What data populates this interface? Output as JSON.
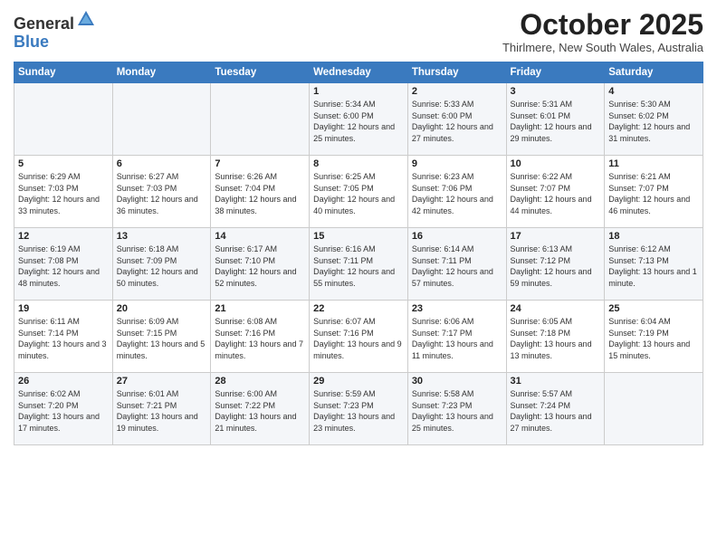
{
  "header": {
    "logo_general": "General",
    "logo_blue": "Blue",
    "month_title": "October 2025",
    "location": "Thirlmere, New South Wales, Australia"
  },
  "weekdays": [
    "Sunday",
    "Monday",
    "Tuesday",
    "Wednesday",
    "Thursday",
    "Friday",
    "Saturday"
  ],
  "weeks": [
    [
      {
        "day": "",
        "sunrise": "",
        "sunset": "",
        "daylight": ""
      },
      {
        "day": "",
        "sunrise": "",
        "sunset": "",
        "daylight": ""
      },
      {
        "day": "",
        "sunrise": "",
        "sunset": "",
        "daylight": ""
      },
      {
        "day": "1",
        "sunrise": "Sunrise: 5:34 AM",
        "sunset": "Sunset: 6:00 PM",
        "daylight": "Daylight: 12 hours and 25 minutes."
      },
      {
        "day": "2",
        "sunrise": "Sunrise: 5:33 AM",
        "sunset": "Sunset: 6:00 PM",
        "daylight": "Daylight: 12 hours and 27 minutes."
      },
      {
        "day": "3",
        "sunrise": "Sunrise: 5:31 AM",
        "sunset": "Sunset: 6:01 PM",
        "daylight": "Daylight: 12 hours and 29 minutes."
      },
      {
        "day": "4",
        "sunrise": "Sunrise: 5:30 AM",
        "sunset": "Sunset: 6:02 PM",
        "daylight": "Daylight: 12 hours and 31 minutes."
      }
    ],
    [
      {
        "day": "5",
        "sunrise": "Sunrise: 6:29 AM",
        "sunset": "Sunset: 7:03 PM",
        "daylight": "Daylight: 12 hours and 33 minutes."
      },
      {
        "day": "6",
        "sunrise": "Sunrise: 6:27 AM",
        "sunset": "Sunset: 7:03 PM",
        "daylight": "Daylight: 12 hours and 36 minutes."
      },
      {
        "day": "7",
        "sunrise": "Sunrise: 6:26 AM",
        "sunset": "Sunset: 7:04 PM",
        "daylight": "Daylight: 12 hours and 38 minutes."
      },
      {
        "day": "8",
        "sunrise": "Sunrise: 6:25 AM",
        "sunset": "Sunset: 7:05 PM",
        "daylight": "Daylight: 12 hours and 40 minutes."
      },
      {
        "day": "9",
        "sunrise": "Sunrise: 6:23 AM",
        "sunset": "Sunset: 7:06 PM",
        "daylight": "Daylight: 12 hours and 42 minutes."
      },
      {
        "day": "10",
        "sunrise": "Sunrise: 6:22 AM",
        "sunset": "Sunset: 7:07 PM",
        "daylight": "Daylight: 12 hours and 44 minutes."
      },
      {
        "day": "11",
        "sunrise": "Sunrise: 6:21 AM",
        "sunset": "Sunset: 7:07 PM",
        "daylight": "Daylight: 12 hours and 46 minutes."
      }
    ],
    [
      {
        "day": "12",
        "sunrise": "Sunrise: 6:19 AM",
        "sunset": "Sunset: 7:08 PM",
        "daylight": "Daylight: 12 hours and 48 minutes."
      },
      {
        "day": "13",
        "sunrise": "Sunrise: 6:18 AM",
        "sunset": "Sunset: 7:09 PM",
        "daylight": "Daylight: 12 hours and 50 minutes."
      },
      {
        "day": "14",
        "sunrise": "Sunrise: 6:17 AM",
        "sunset": "Sunset: 7:10 PM",
        "daylight": "Daylight: 12 hours and 52 minutes."
      },
      {
        "day": "15",
        "sunrise": "Sunrise: 6:16 AM",
        "sunset": "Sunset: 7:11 PM",
        "daylight": "Daylight: 12 hours and 55 minutes."
      },
      {
        "day": "16",
        "sunrise": "Sunrise: 6:14 AM",
        "sunset": "Sunset: 7:11 PM",
        "daylight": "Daylight: 12 hours and 57 minutes."
      },
      {
        "day": "17",
        "sunrise": "Sunrise: 6:13 AM",
        "sunset": "Sunset: 7:12 PM",
        "daylight": "Daylight: 12 hours and 59 minutes."
      },
      {
        "day": "18",
        "sunrise": "Sunrise: 6:12 AM",
        "sunset": "Sunset: 7:13 PM",
        "daylight": "Daylight: 13 hours and 1 minute."
      }
    ],
    [
      {
        "day": "19",
        "sunrise": "Sunrise: 6:11 AM",
        "sunset": "Sunset: 7:14 PM",
        "daylight": "Daylight: 13 hours and 3 minutes."
      },
      {
        "day": "20",
        "sunrise": "Sunrise: 6:09 AM",
        "sunset": "Sunset: 7:15 PM",
        "daylight": "Daylight: 13 hours and 5 minutes."
      },
      {
        "day": "21",
        "sunrise": "Sunrise: 6:08 AM",
        "sunset": "Sunset: 7:16 PM",
        "daylight": "Daylight: 13 hours and 7 minutes."
      },
      {
        "day": "22",
        "sunrise": "Sunrise: 6:07 AM",
        "sunset": "Sunset: 7:16 PM",
        "daylight": "Daylight: 13 hours and 9 minutes."
      },
      {
        "day": "23",
        "sunrise": "Sunrise: 6:06 AM",
        "sunset": "Sunset: 7:17 PM",
        "daylight": "Daylight: 13 hours and 11 minutes."
      },
      {
        "day": "24",
        "sunrise": "Sunrise: 6:05 AM",
        "sunset": "Sunset: 7:18 PM",
        "daylight": "Daylight: 13 hours and 13 minutes."
      },
      {
        "day": "25",
        "sunrise": "Sunrise: 6:04 AM",
        "sunset": "Sunset: 7:19 PM",
        "daylight": "Daylight: 13 hours and 15 minutes."
      }
    ],
    [
      {
        "day": "26",
        "sunrise": "Sunrise: 6:02 AM",
        "sunset": "Sunset: 7:20 PM",
        "daylight": "Daylight: 13 hours and 17 minutes."
      },
      {
        "day": "27",
        "sunrise": "Sunrise: 6:01 AM",
        "sunset": "Sunset: 7:21 PM",
        "daylight": "Daylight: 13 hours and 19 minutes."
      },
      {
        "day": "28",
        "sunrise": "Sunrise: 6:00 AM",
        "sunset": "Sunset: 7:22 PM",
        "daylight": "Daylight: 13 hours and 21 minutes."
      },
      {
        "day": "29",
        "sunrise": "Sunrise: 5:59 AM",
        "sunset": "Sunset: 7:23 PM",
        "daylight": "Daylight: 13 hours and 23 minutes."
      },
      {
        "day": "30",
        "sunrise": "Sunrise: 5:58 AM",
        "sunset": "Sunset: 7:23 PM",
        "daylight": "Daylight: 13 hours and 25 minutes."
      },
      {
        "day": "31",
        "sunrise": "Sunrise: 5:57 AM",
        "sunset": "Sunset: 7:24 PM",
        "daylight": "Daylight: 13 hours and 27 minutes."
      },
      {
        "day": "",
        "sunrise": "",
        "sunset": "",
        "daylight": ""
      }
    ]
  ]
}
